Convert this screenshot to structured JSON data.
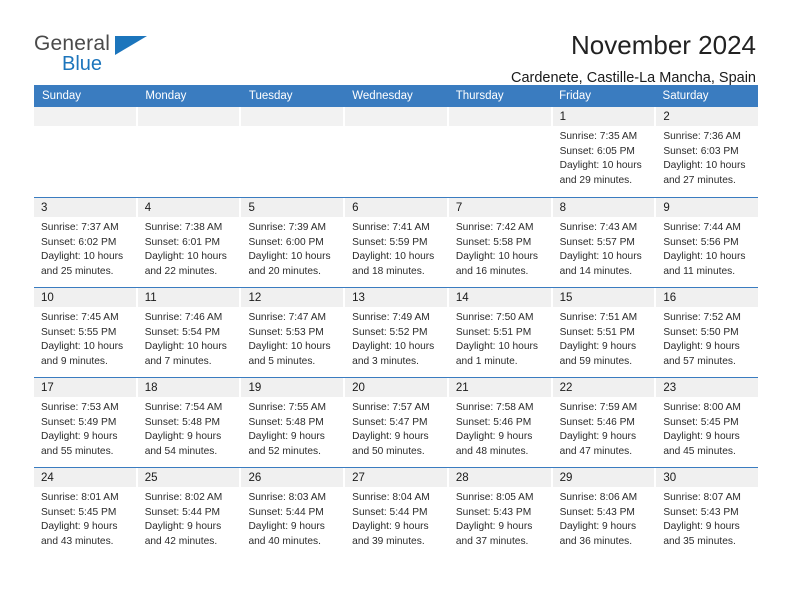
{
  "logo": {
    "word_one": "General",
    "word_two": "Blue",
    "accent_color": "#1c75bc",
    "triangle_icon": "triangle-icon"
  },
  "header": {
    "title": "November 2024",
    "subtitle": "Cardenete, Castille-La Mancha, Spain"
  },
  "theme": {
    "header_row_bg": "#3a7cc0",
    "daynum_band_bg": "#f0f0f0",
    "row_divider": "#3a7cc0",
    "text": "#2b2b2b"
  },
  "weekdays": [
    "Sunday",
    "Monday",
    "Tuesday",
    "Wednesday",
    "Thursday",
    "Friday",
    "Saturday"
  ],
  "weeks": [
    [
      {
        "day": "",
        "empty": true,
        "lines": []
      },
      {
        "day": "",
        "empty": true,
        "lines": []
      },
      {
        "day": "",
        "empty": true,
        "lines": []
      },
      {
        "day": "",
        "empty": true,
        "lines": []
      },
      {
        "day": "",
        "empty": true,
        "lines": []
      },
      {
        "day": "1",
        "empty": false,
        "lines": [
          "Sunrise: 7:35 AM",
          "Sunset: 6:05 PM",
          "Daylight: 10 hours",
          "and 29 minutes."
        ]
      },
      {
        "day": "2",
        "empty": false,
        "lines": [
          "Sunrise: 7:36 AM",
          "Sunset: 6:03 PM",
          "Daylight: 10 hours",
          "and 27 minutes."
        ]
      }
    ],
    [
      {
        "day": "3",
        "empty": false,
        "lines": [
          "Sunrise: 7:37 AM",
          "Sunset: 6:02 PM",
          "Daylight: 10 hours",
          "and 25 minutes."
        ]
      },
      {
        "day": "4",
        "empty": false,
        "lines": [
          "Sunrise: 7:38 AM",
          "Sunset: 6:01 PM",
          "Daylight: 10 hours",
          "and 22 minutes."
        ]
      },
      {
        "day": "5",
        "empty": false,
        "lines": [
          "Sunrise: 7:39 AM",
          "Sunset: 6:00 PM",
          "Daylight: 10 hours",
          "and 20 minutes."
        ]
      },
      {
        "day": "6",
        "empty": false,
        "lines": [
          "Sunrise: 7:41 AM",
          "Sunset: 5:59 PM",
          "Daylight: 10 hours",
          "and 18 minutes."
        ]
      },
      {
        "day": "7",
        "empty": false,
        "lines": [
          "Sunrise: 7:42 AM",
          "Sunset: 5:58 PM",
          "Daylight: 10 hours",
          "and 16 minutes."
        ]
      },
      {
        "day": "8",
        "empty": false,
        "lines": [
          "Sunrise: 7:43 AM",
          "Sunset: 5:57 PM",
          "Daylight: 10 hours",
          "and 14 minutes."
        ]
      },
      {
        "day": "9",
        "empty": false,
        "lines": [
          "Sunrise: 7:44 AM",
          "Sunset: 5:56 PM",
          "Daylight: 10 hours",
          "and 11 minutes."
        ]
      }
    ],
    [
      {
        "day": "10",
        "empty": false,
        "lines": [
          "Sunrise: 7:45 AM",
          "Sunset: 5:55 PM",
          "Daylight: 10 hours",
          "and 9 minutes."
        ]
      },
      {
        "day": "11",
        "empty": false,
        "lines": [
          "Sunrise: 7:46 AM",
          "Sunset: 5:54 PM",
          "Daylight: 10 hours",
          "and 7 minutes."
        ]
      },
      {
        "day": "12",
        "empty": false,
        "lines": [
          "Sunrise: 7:47 AM",
          "Sunset: 5:53 PM",
          "Daylight: 10 hours",
          "and 5 minutes."
        ]
      },
      {
        "day": "13",
        "empty": false,
        "lines": [
          "Sunrise: 7:49 AM",
          "Sunset: 5:52 PM",
          "Daylight: 10 hours",
          "and 3 minutes."
        ]
      },
      {
        "day": "14",
        "empty": false,
        "lines": [
          "Sunrise: 7:50 AM",
          "Sunset: 5:51 PM",
          "Daylight: 10 hours",
          "and 1 minute."
        ]
      },
      {
        "day": "15",
        "empty": false,
        "lines": [
          "Sunrise: 7:51 AM",
          "Sunset: 5:51 PM",
          "Daylight: 9 hours",
          "and 59 minutes."
        ]
      },
      {
        "day": "16",
        "empty": false,
        "lines": [
          "Sunrise: 7:52 AM",
          "Sunset: 5:50 PM",
          "Daylight: 9 hours",
          "and 57 minutes."
        ]
      }
    ],
    [
      {
        "day": "17",
        "empty": false,
        "lines": [
          "Sunrise: 7:53 AM",
          "Sunset: 5:49 PM",
          "Daylight: 9 hours",
          "and 55 minutes."
        ]
      },
      {
        "day": "18",
        "empty": false,
        "lines": [
          "Sunrise: 7:54 AM",
          "Sunset: 5:48 PM",
          "Daylight: 9 hours",
          "and 54 minutes."
        ]
      },
      {
        "day": "19",
        "empty": false,
        "lines": [
          "Sunrise: 7:55 AM",
          "Sunset: 5:48 PM",
          "Daylight: 9 hours",
          "and 52 minutes."
        ]
      },
      {
        "day": "20",
        "empty": false,
        "lines": [
          "Sunrise: 7:57 AM",
          "Sunset: 5:47 PM",
          "Daylight: 9 hours",
          "and 50 minutes."
        ]
      },
      {
        "day": "21",
        "empty": false,
        "lines": [
          "Sunrise: 7:58 AM",
          "Sunset: 5:46 PM",
          "Daylight: 9 hours",
          "and 48 minutes."
        ]
      },
      {
        "day": "22",
        "empty": false,
        "lines": [
          "Sunrise: 7:59 AM",
          "Sunset: 5:46 PM",
          "Daylight: 9 hours",
          "and 47 minutes."
        ]
      },
      {
        "day": "23",
        "empty": false,
        "lines": [
          "Sunrise: 8:00 AM",
          "Sunset: 5:45 PM",
          "Daylight: 9 hours",
          "and 45 minutes."
        ]
      }
    ],
    [
      {
        "day": "24",
        "empty": false,
        "lines": [
          "Sunrise: 8:01 AM",
          "Sunset: 5:45 PM",
          "Daylight: 9 hours",
          "and 43 minutes."
        ]
      },
      {
        "day": "25",
        "empty": false,
        "lines": [
          "Sunrise: 8:02 AM",
          "Sunset: 5:44 PM",
          "Daylight: 9 hours",
          "and 42 minutes."
        ]
      },
      {
        "day": "26",
        "empty": false,
        "lines": [
          "Sunrise: 8:03 AM",
          "Sunset: 5:44 PM",
          "Daylight: 9 hours",
          "and 40 minutes."
        ]
      },
      {
        "day": "27",
        "empty": false,
        "lines": [
          "Sunrise: 8:04 AM",
          "Sunset: 5:44 PM",
          "Daylight: 9 hours",
          "and 39 minutes."
        ]
      },
      {
        "day": "28",
        "empty": false,
        "lines": [
          "Sunrise: 8:05 AM",
          "Sunset: 5:43 PM",
          "Daylight: 9 hours",
          "and 37 minutes."
        ]
      },
      {
        "day": "29",
        "empty": false,
        "lines": [
          "Sunrise: 8:06 AM",
          "Sunset: 5:43 PM",
          "Daylight: 9 hours",
          "and 36 minutes."
        ]
      },
      {
        "day": "30",
        "empty": false,
        "lines": [
          "Sunrise: 8:07 AM",
          "Sunset: 5:43 PM",
          "Daylight: 9 hours",
          "and 35 minutes."
        ]
      }
    ]
  ]
}
